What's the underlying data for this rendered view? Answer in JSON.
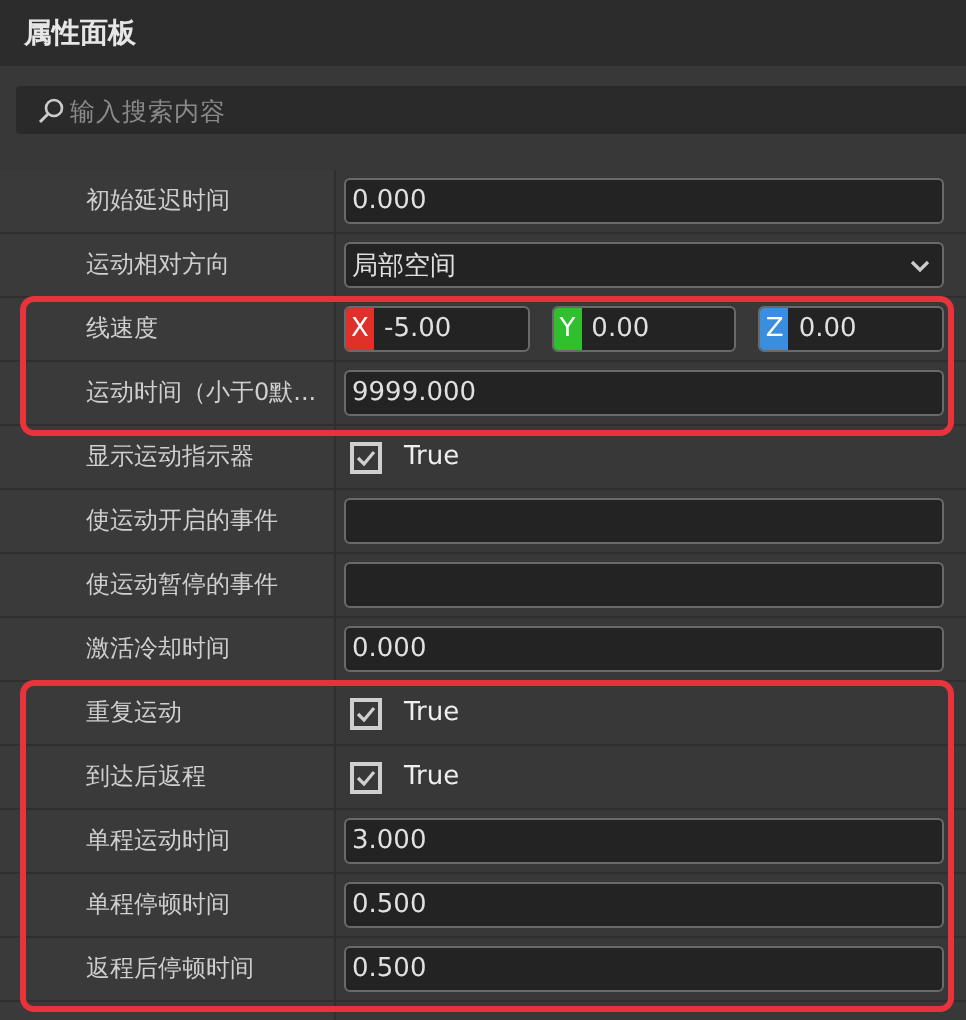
{
  "panel": {
    "title": "属性面板"
  },
  "search": {
    "placeholder": "输入搜索内容"
  },
  "sections": [
    {
      "highlighted": false,
      "rows": [
        {
          "kind": "text",
          "label": "初始延迟时间",
          "value": "0.000"
        },
        {
          "kind": "dropdown",
          "label": "运动相对方向",
          "value": "局部空间"
        }
      ]
    },
    {
      "highlighted": true,
      "rows": [
        {
          "kind": "vector",
          "label": "线速度",
          "components": [
            {
              "axis": "X",
              "color": "#e0302a",
              "value": "-5.00"
            },
            {
              "axis": "Y",
              "color": "#2fbf2f",
              "value": "0.00"
            },
            {
              "axis": "Z",
              "color": "#3a8ee0",
              "value": "0.00"
            }
          ]
        },
        {
          "kind": "text",
          "label": "运动时间（小于0默...",
          "value": "9999.000"
        }
      ]
    },
    {
      "highlighted": false,
      "rows": [
        {
          "kind": "checkbox",
          "label": "显示运动指示器",
          "checked": true,
          "value": "True"
        },
        {
          "kind": "text",
          "label": "使运动开启的事件"
        },
        {
          "kind": "text",
          "label": "使运动暂停的事件"
        },
        {
          "kind": "text",
          "label": "激活冷却时间",
          "value": "0.000"
        }
      ]
    },
    {
      "highlighted": true,
      "rows": [
        {
          "kind": "checkbox",
          "label": "重复运动",
          "checked": true,
          "value": "True"
        },
        {
          "kind": "checkbox",
          "label": "到达后返程",
          "checked": true,
          "value": "True"
        },
        {
          "kind": "text",
          "label": "单程运动时间",
          "value": "3.000"
        },
        {
          "kind": "text",
          "label": "单程停顿时间",
          "value": "0.500"
        },
        {
          "kind": "text",
          "label": "返程后停顿时间",
          "value": "0.500"
        }
      ]
    }
  ]
}
